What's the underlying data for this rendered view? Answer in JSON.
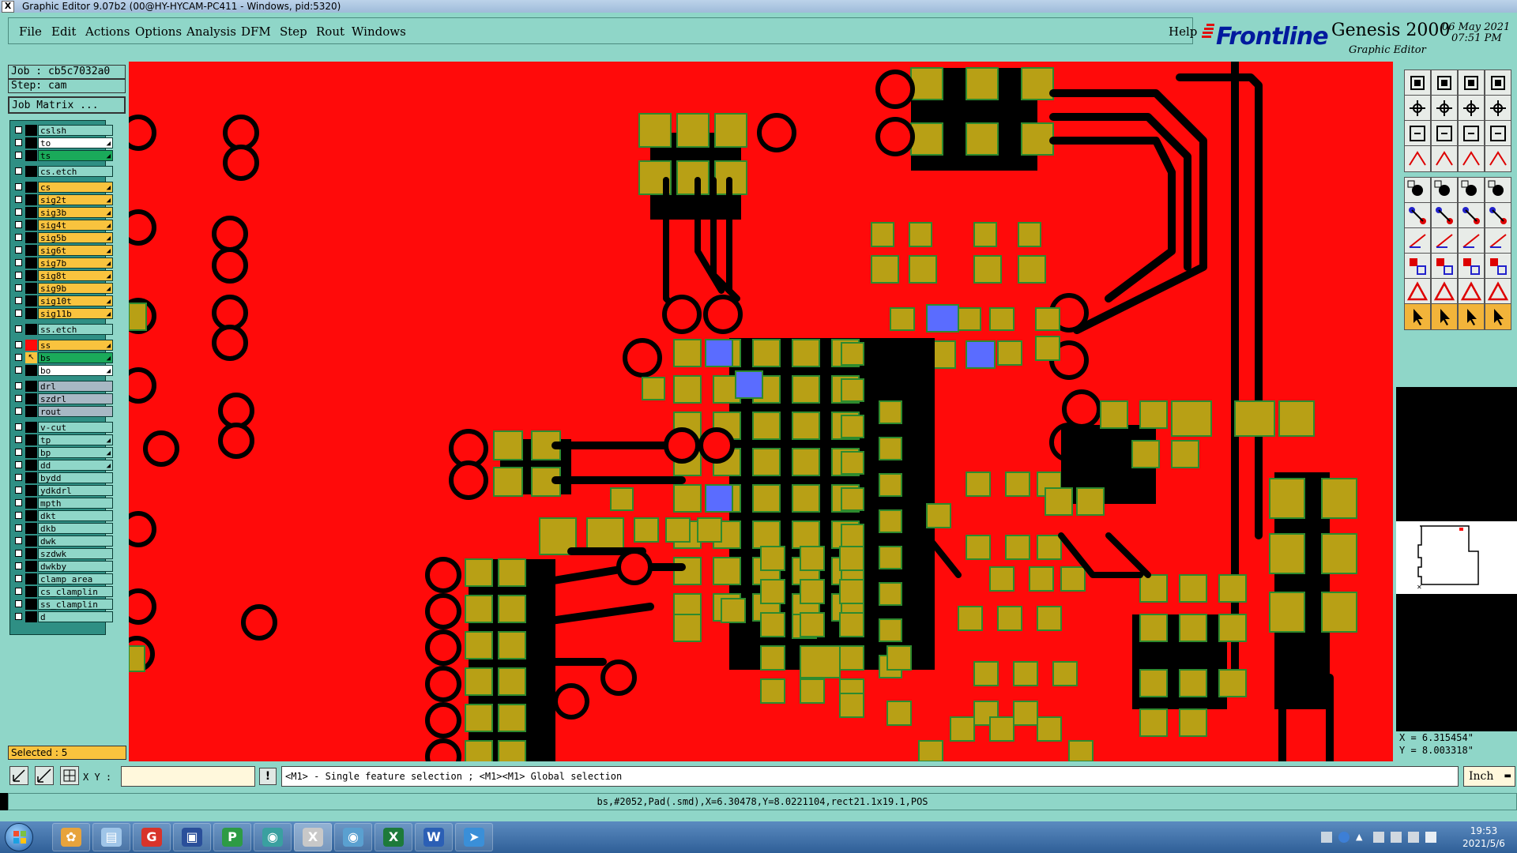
{
  "window": {
    "title": "Graphic Editor 9.07b2 (00@HY-HYCAM-PC411 - Windows, pid:5320)"
  },
  "menu": {
    "items": [
      "File",
      "Edit",
      "Actions",
      "Options",
      "Analysis",
      "DFM",
      "Step",
      "Rout",
      "Windows"
    ],
    "help": "Help"
  },
  "brand": {
    "logo": "Frontline",
    "product": "Genesis 2000",
    "subtitle": "Graphic Editor",
    "date": "06 May 2021",
    "time": "07:51 PM"
  },
  "job": {
    "job_label": "Job : cb5c7032a0",
    "step_label": "Step: cam",
    "matrix_button": "Job Matrix ..."
  },
  "layers": [
    {
      "name": "cslsh",
      "color": "#8fd6c8",
      "gap": false
    },
    {
      "name": "to",
      "color": "#ffffff",
      "gap": false,
      "arrow": true
    },
    {
      "name": "ts",
      "color": "#1aaa5a",
      "gap": false,
      "arrow": true
    },
    {
      "name": "cs.etch",
      "color": "#8fd6c8",
      "gap": true
    },
    {
      "name": "cs",
      "color": "#f9c33e",
      "gap": true,
      "arrow": true
    },
    {
      "name": "sig2t",
      "color": "#f9c33e",
      "gap": false,
      "arrow": true
    },
    {
      "name": "sig3b",
      "color": "#f9c33e",
      "gap": false,
      "arrow": true
    },
    {
      "name": "sig4t",
      "color": "#f9c33e",
      "gap": false,
      "arrow": true
    },
    {
      "name": "sig5b",
      "color": "#f9c33e",
      "gap": false,
      "arrow": true
    },
    {
      "name": "sig6t",
      "color": "#f9c33e",
      "gap": false,
      "arrow": true
    },
    {
      "name": "sig7b",
      "color": "#f9c33e",
      "gap": false,
      "arrow": true
    },
    {
      "name": "sig8t",
      "color": "#f9c33e",
      "gap": false,
      "arrow": true
    },
    {
      "name": "sig9b",
      "color": "#f9c33e",
      "gap": false,
      "arrow": true
    },
    {
      "name": "sig10t",
      "color": "#f9c33e",
      "gap": false,
      "arrow": true
    },
    {
      "name": "sig11b",
      "color": "#f9c33e",
      "gap": false,
      "arrow": true
    },
    {
      "name": "ss.etch",
      "color": "#8fd6c8",
      "gap": true
    },
    {
      "name": "ss",
      "color": "#f9c33e",
      "gap": true,
      "arrow": true,
      "swatch": "#ff0a0a"
    },
    {
      "name": "bs",
      "color": "#1aaa5a",
      "gap": false,
      "arrow": true,
      "swatch": "#f9c33e",
      "active": true
    },
    {
      "name": "bo",
      "color": "#ffffff",
      "gap": false,
      "arrow": true
    },
    {
      "name": "drl",
      "color": "#a8b8c4",
      "gap": true
    },
    {
      "name": "szdrl",
      "color": "#a8b8c4",
      "gap": false
    },
    {
      "name": "rout",
      "color": "#a8b8c4",
      "gap": false
    },
    {
      "name": "v-cut",
      "color": "#8fd6c8",
      "gap": true
    },
    {
      "name": "tp",
      "color": "#8fd6c8",
      "gap": false,
      "arrow": true
    },
    {
      "name": "bp",
      "color": "#8fd6c8",
      "gap": false,
      "arrow": true
    },
    {
      "name": "dd",
      "color": "#8fd6c8",
      "gap": false,
      "arrow": true
    },
    {
      "name": "bydd",
      "color": "#8fd6c8",
      "gap": false
    },
    {
      "name": "ydkdrl",
      "color": "#8fd6c8",
      "gap": false
    },
    {
      "name": "mpth",
      "color": "#8fd6c8",
      "gap": false
    },
    {
      "name": "dkt",
      "color": "#8fd6c8",
      "gap": false
    },
    {
      "name": "dkb",
      "color": "#8fd6c8",
      "gap": false
    },
    {
      "name": "dwk",
      "color": "#8fd6c8",
      "gap": false
    },
    {
      "name": "szdwk",
      "color": "#8fd6c8",
      "gap": false
    },
    {
      "name": "dwkby",
      "color": "#8fd6c8",
      "gap": false
    },
    {
      "name": "clamp_area",
      "color": "#8fd6c8",
      "gap": false
    },
    {
      "name": "cs_clamplin",
      "color": "#8fd6c8",
      "gap": false
    },
    {
      "name": "ss_clamplin",
      "color": "#8fd6c8",
      "gap": false
    },
    {
      "name": "d",
      "color": "#8fd6c8",
      "gap": false
    }
  ],
  "selection": {
    "label": "Selected : 5"
  },
  "cursor": {
    "x": "X = 6.315454\"",
    "y": "Y = 8.003318\""
  },
  "bottom": {
    "xy_label": "X Y :",
    "xy_value": "",
    "exclaim": "!",
    "hint": "<M1> - Single feature selection ; <M1><M1> Global selection",
    "unit": "Inch"
  },
  "status": {
    "feature": "bs,#2052,Pad(.smd),X=6.30478,Y=8.0221104,rect21.1x19.1,POS"
  },
  "taskbar": {
    "time": "19:53",
    "date": "2021/5/6"
  },
  "colors": {
    "board": "#ff0a0a",
    "copper": "#b8a015",
    "selected": "#5a6cff",
    "panel": "#8fd6c8"
  },
  "icons": [
    "start-orb-icon",
    "shell-icon",
    "notepad-icon",
    "browser-icon",
    "save-disk-icon",
    "cam-p-icon",
    "eye-app-icon",
    "x-app-icon",
    "eye-green-icon",
    "excel-icon",
    "word-icon",
    "bird-app-icon"
  ]
}
